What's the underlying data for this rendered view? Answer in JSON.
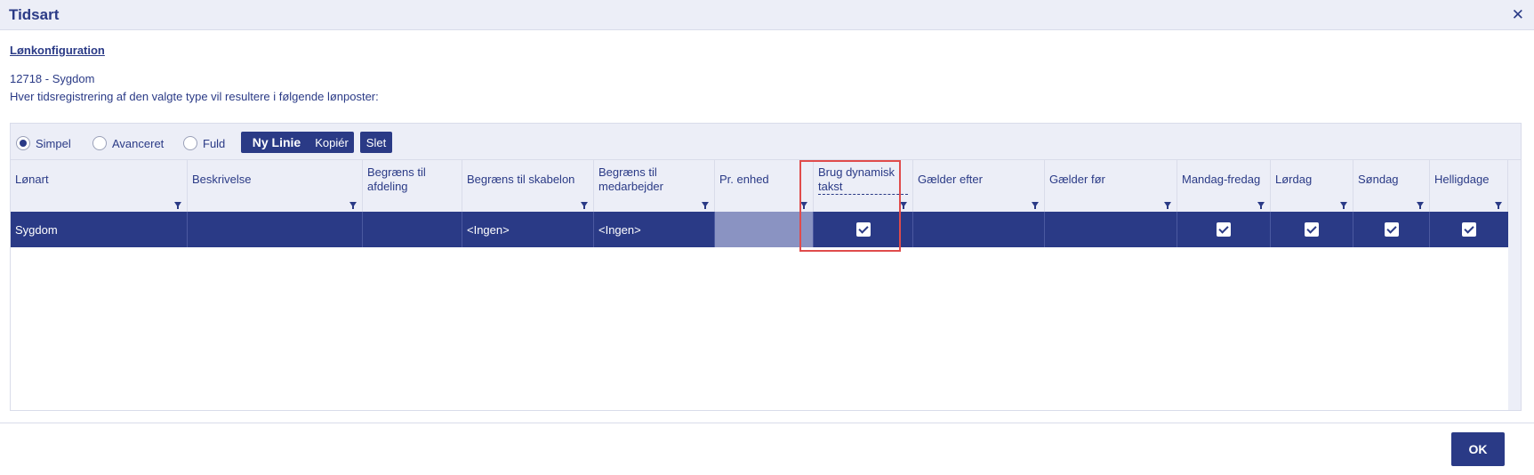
{
  "dialog": {
    "title": "Tidsart",
    "close_icon": "close-icon"
  },
  "section": {
    "link": "Lønkonfiguration"
  },
  "info": {
    "code_line": "12718 - Sygdom",
    "description": "Hver tidsregistrering af den valgte type vil resultere i følgende lønposter:"
  },
  "toolbar": {
    "radios": [
      {
        "label": "Simpel",
        "selected": true
      },
      {
        "label": "Avanceret",
        "selected": false
      },
      {
        "label": "Fuld",
        "selected": false
      }
    ],
    "new_line": "Ny Linie",
    "copy": "Kopiér",
    "delete": "Slet"
  },
  "table": {
    "columns": [
      "Lønart",
      "Beskrivelse",
      "Begræns til afdeling",
      "Begræns til skabelon",
      "Begræns til medarbejder",
      "Pr. enhed",
      "Brug dynamisk takst",
      "Gælder efter",
      "Gælder før",
      "Mandag-fredag",
      "Lørdag",
      "Søndag",
      "Helligdage"
    ],
    "rows": [
      {
        "lonart": "Sygdom",
        "beskrivelse": "",
        "afdeling": "",
        "skabelon": "<Ingen>",
        "medarbejder": "<Ingen>",
        "pr_enhed": "",
        "dynamisk_takst": true,
        "gaelder_efter": "",
        "gaelder_for": "",
        "mandag_fredag": true,
        "lordag": true,
        "sondag": true,
        "helligdage": true
      }
    ]
  },
  "footer": {
    "ok": "OK"
  },
  "colors": {
    "primary": "#2a3a86",
    "header_bg": "#eceef7",
    "highlight": "#e04b4b"
  }
}
